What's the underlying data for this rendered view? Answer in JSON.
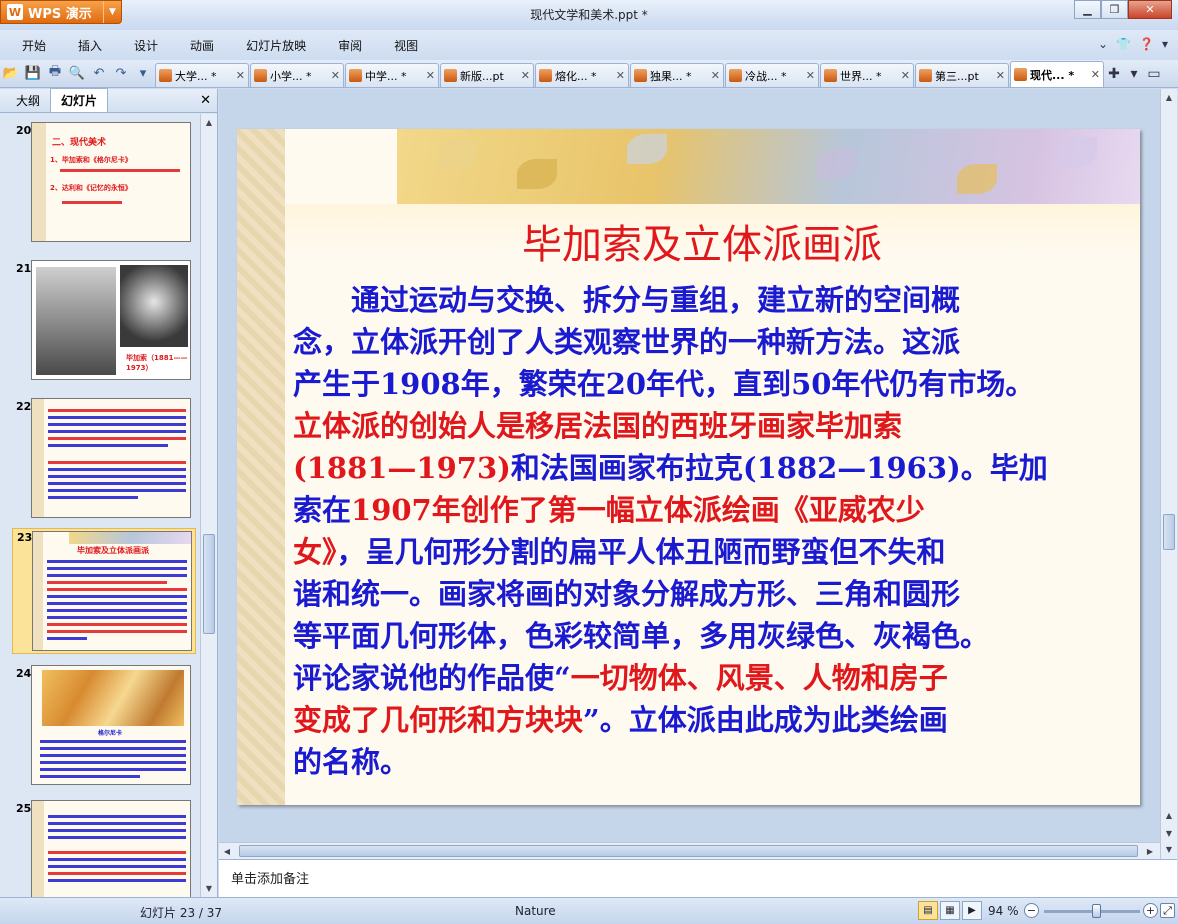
{
  "app": {
    "name": "WPS 演示",
    "document_title": "现代文学和美术.ppt *"
  },
  "menu": [
    "开始",
    "插入",
    "设计",
    "动画",
    "幻灯片放映",
    "审阅",
    "视图"
  ],
  "tabs": [
    {
      "label": "大学... *",
      "active": false
    },
    {
      "label": "小学... *",
      "active": false
    },
    {
      "label": "中学... *",
      "active": false
    },
    {
      "label": "新版...pt",
      "active": false
    },
    {
      "label": "熔化... *",
      "active": false
    },
    {
      "label": "独果... *",
      "active": false
    },
    {
      "label": "冷战... *",
      "active": false
    },
    {
      "label": "世界... *",
      "active": false
    },
    {
      "label": "第三...pt",
      "active": false
    },
    {
      "label": "现代... *",
      "active": true
    }
  ],
  "left_panel": {
    "tabs": [
      "大纲",
      "幻灯片"
    ],
    "active_tab": "幻灯片"
  },
  "thumbnails": [
    {
      "num": "20",
      "title": "二、现代美术",
      "items": [
        "1、毕加索和《格尔尼卡》",
        "2、达利和《记忆的永恒》"
      ]
    },
    {
      "num": "21",
      "caption": "毕加索（1881——1973）"
    },
    {
      "num": "22",
      "selected": false
    },
    {
      "num": "23",
      "title": "毕加索及立体派画派",
      "selected": true
    },
    {
      "num": "24",
      "caption": "格尔尼卡"
    },
    {
      "num": "25",
      "selected": false
    }
  ],
  "slide": {
    "title": "毕加索及立体派画派",
    "lines": [
      [
        {
          "t": "　　通过运动与交换、拆分与重组，建立新的空间概",
          "c": "b"
        }
      ],
      [
        {
          "t": "念，立体派开创了人类观察世界的一种新方法。这派",
          "c": "b"
        }
      ],
      [
        {
          "t": "产生于1908年，繁荣在20年代，直到50年代仍有市场。",
          "c": "b"
        }
      ],
      [
        {
          "t": "立体派的创始人是移居法国的西班牙画家毕加索",
          "c": "r"
        }
      ],
      [
        {
          "t": "(1881—1973)",
          "c": "r"
        },
        {
          "t": "和法国画家布拉克(1882—1963)。毕加",
          "c": "b"
        }
      ],
      [
        {
          "t": "索在",
          "c": "b"
        },
        {
          "t": "1907年创作了第一幅立体派绘画《亚威农少",
          "c": "r"
        }
      ],
      [
        {
          "t": "女》",
          "c": "r"
        },
        {
          "t": "，呈几何形分割的扁平人体丑陋而野蛮但不失和",
          "c": "b"
        }
      ],
      [
        {
          "t": "谐和统一。画家将画的对象分解成方形、三角和圆形",
          "c": "b"
        }
      ],
      [
        {
          "t": "等平面几何形体，色彩较简单，多用灰绿色、灰褐色。",
          "c": "b"
        }
      ],
      [
        {
          "t": "评论家说他的作品使“",
          "c": "b"
        },
        {
          "t": "一切物体、风景、人物和房子",
          "c": "r"
        }
      ],
      [
        {
          "t": "变成了几何形和方块块",
          "c": "r"
        },
        {
          "t": "”。立体派由此成为此类绘画",
          "c": "b"
        }
      ],
      [
        {
          "t": "的名称。",
          "c": "b"
        }
      ]
    ]
  },
  "notes_placeholder": "单击添加备注",
  "status": {
    "slide_info": "幻灯片 23 / 37",
    "theme": "Nature",
    "zoom": "94 %",
    "zoom_level_fraction": 0.55
  },
  "colors": {
    "title_red": "#e0181b",
    "body_blue": "#1a1ad0",
    "accent_orange": "#e06a10"
  }
}
